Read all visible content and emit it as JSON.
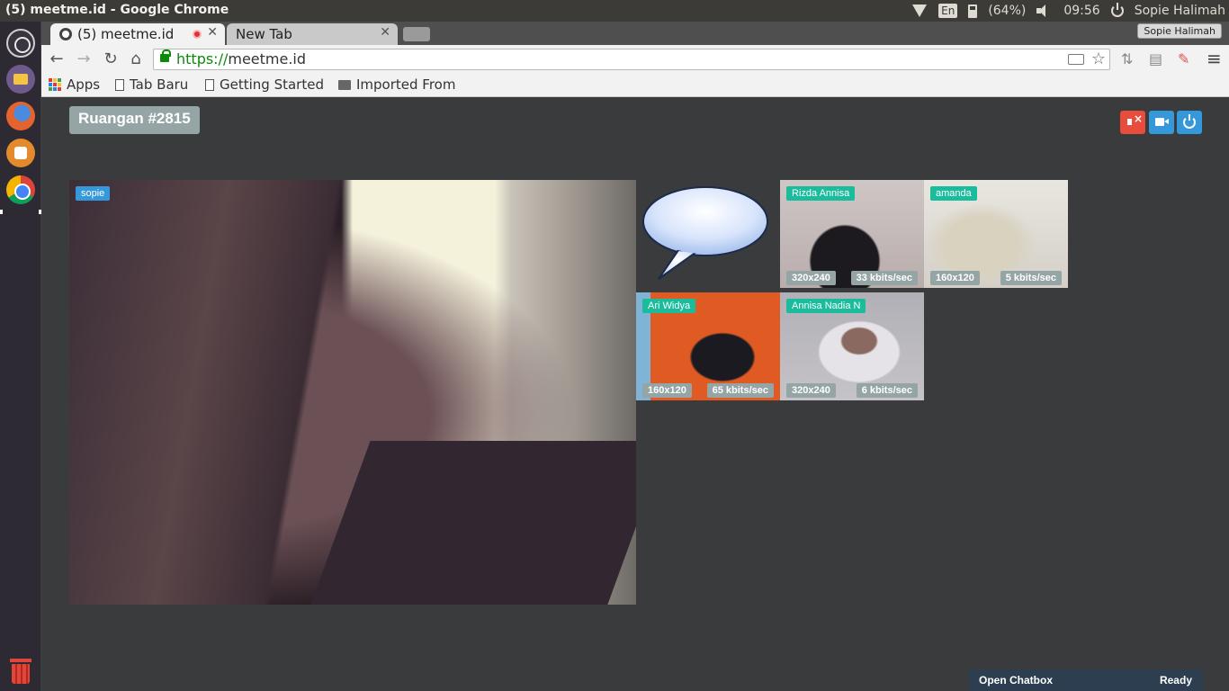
{
  "os_panel": {
    "window_title": "(5) meetme.id - Google Chrome",
    "keyboard_layout": "En",
    "battery": "(64%)",
    "clock": "09:56",
    "user": "Sopie Halimah"
  },
  "browser": {
    "tabs": [
      {
        "label": "(5) meetme.id",
        "active": true,
        "recording": true
      },
      {
        "label": "New Tab",
        "active": false
      }
    ],
    "profile": "Sopie Halimah",
    "url_scheme": "https://",
    "url_host": "meetme.id",
    "bookmarks": [
      "Apps",
      "Tab Baru",
      "Getting Started",
      "Imported From"
    ]
  },
  "room": {
    "title": "Ruangan #2815",
    "controls": [
      "mute-audio",
      "camera",
      "leave"
    ]
  },
  "videos": {
    "main": {
      "name": "sopie"
    },
    "participants": [
      {
        "name": "Rizda Annisa",
        "resolution": "320x240",
        "bitrate": "33 kbits/sec"
      },
      {
        "name": "amanda",
        "resolution": "160x120",
        "bitrate": "5 kbits/sec"
      },
      {
        "name": "Ari Widya",
        "resolution": "160x120",
        "bitrate": "65 kbits/sec"
      },
      {
        "name": "Annisa Nadia N",
        "resolution": "320x240",
        "bitrate": "6 kbits/sec"
      }
    ]
  },
  "chatbox": {
    "open_label": "Open Chatbox",
    "status": "Ready"
  },
  "colors": {
    "danger": "#e74c3c",
    "primary": "#3498db",
    "name_tag_green": "#1abc9c",
    "chatbar": "#2c3e50"
  }
}
